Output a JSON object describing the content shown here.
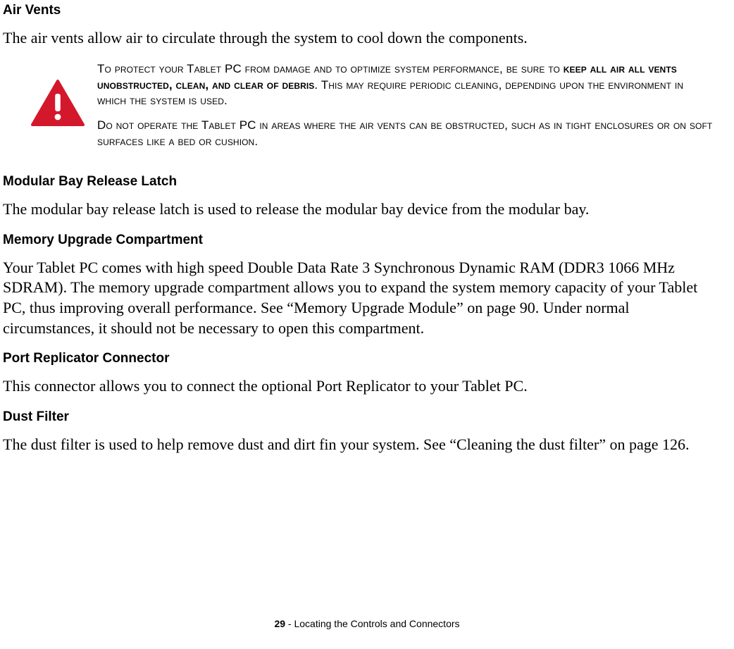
{
  "sections": {
    "airVents": {
      "heading": "Air Vents",
      "body": "The air vents allow air to circulate through the system to cool down the components."
    },
    "warning": {
      "p1_pre": "To protect your Tablet PC from damage and to optimize system performance, be sure to ",
      "p1_bold": "keep all air all vents unobstructed, clean, and clear of debris",
      "p1_post": ". This may require periodic cleaning, depending upon the environment in which the system is used.",
      "p2": "Do not operate the Tablet PC in areas where the air vents can be obstructed, such as in tight enclosures or on soft surfaces like a bed or cushion."
    },
    "modularBay": {
      "heading": "Modular Bay Release Latch",
      "body": "The modular bay release latch is used to release the modular bay device from the modular bay."
    },
    "memoryUpgrade": {
      "heading": "Memory Upgrade Compartment",
      "body": "Your Tablet PC comes with high speed Double Data Rate 3 Synchronous Dynamic RAM (DDR3 1066 MHz SDRAM). The memory upgrade compartment allows you to expand the system memory capacity of your Tablet PC, thus improving overall performance. See “Memory Upgrade Module” on page 90. Under normal circumstances, it should not be necessary to open this compartment."
    },
    "portReplicator": {
      "heading": "Port Replicator Connector",
      "body": "This connector allows you to connect the optional Port Replicator to your Tablet PC."
    },
    "dustFilter": {
      "heading": "Dust Filter",
      "body": "The dust filter is used to help remove dust and dirt fin your system. See “Cleaning the dust filter” on page 126."
    }
  },
  "footer": {
    "pageNumber": "29",
    "separator": " - ",
    "title": "Locating the Controls and Connectors"
  }
}
